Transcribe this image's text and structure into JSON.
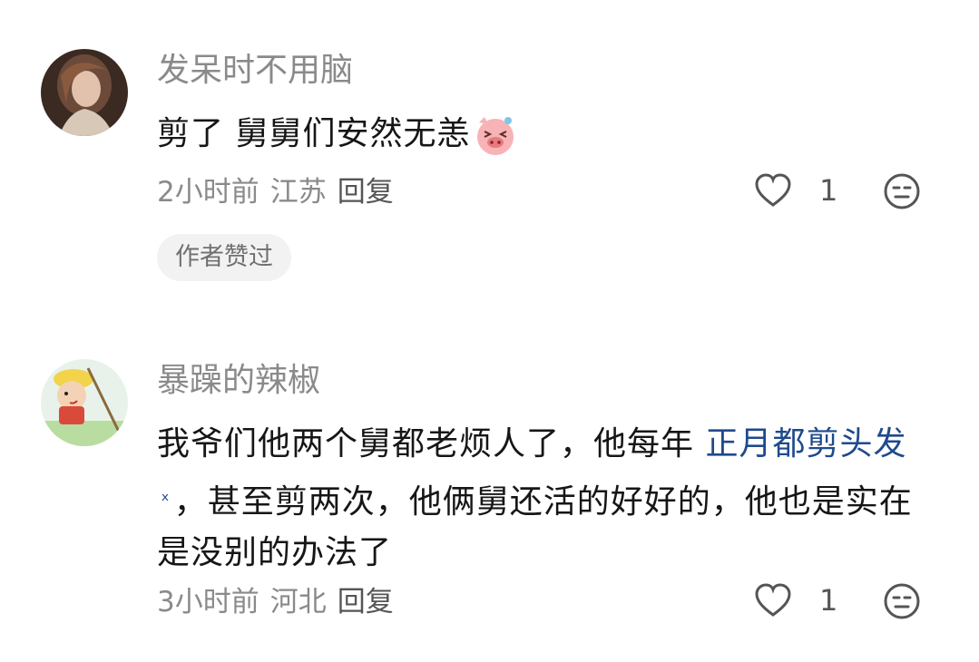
{
  "comments": [
    {
      "username": "发呆时不用脑",
      "text": "剪了 舅舅们安然无恙",
      "emoji": "laughing-pig-emoji",
      "time": "2小时前",
      "location": "江苏",
      "reply_label": "回复",
      "likes": "1",
      "badge": "作者赞过"
    },
    {
      "username": "暴躁的辣椒",
      "text_before": "我爷们他两个舅都老烦人了，他每年 ",
      "link_text": "正月都剪头发",
      "text_after": "，甚至剪两次，他俩舅还活的好好的，他也是实在是没别的办法了",
      "time": "3小时前",
      "location": "河北",
      "reply_label": "回复",
      "likes": "1"
    }
  ],
  "colors": {
    "username": "#8a8a8a",
    "text": "#161616",
    "link": "#1f4a8c",
    "badge_bg": "#f2f2f2"
  }
}
